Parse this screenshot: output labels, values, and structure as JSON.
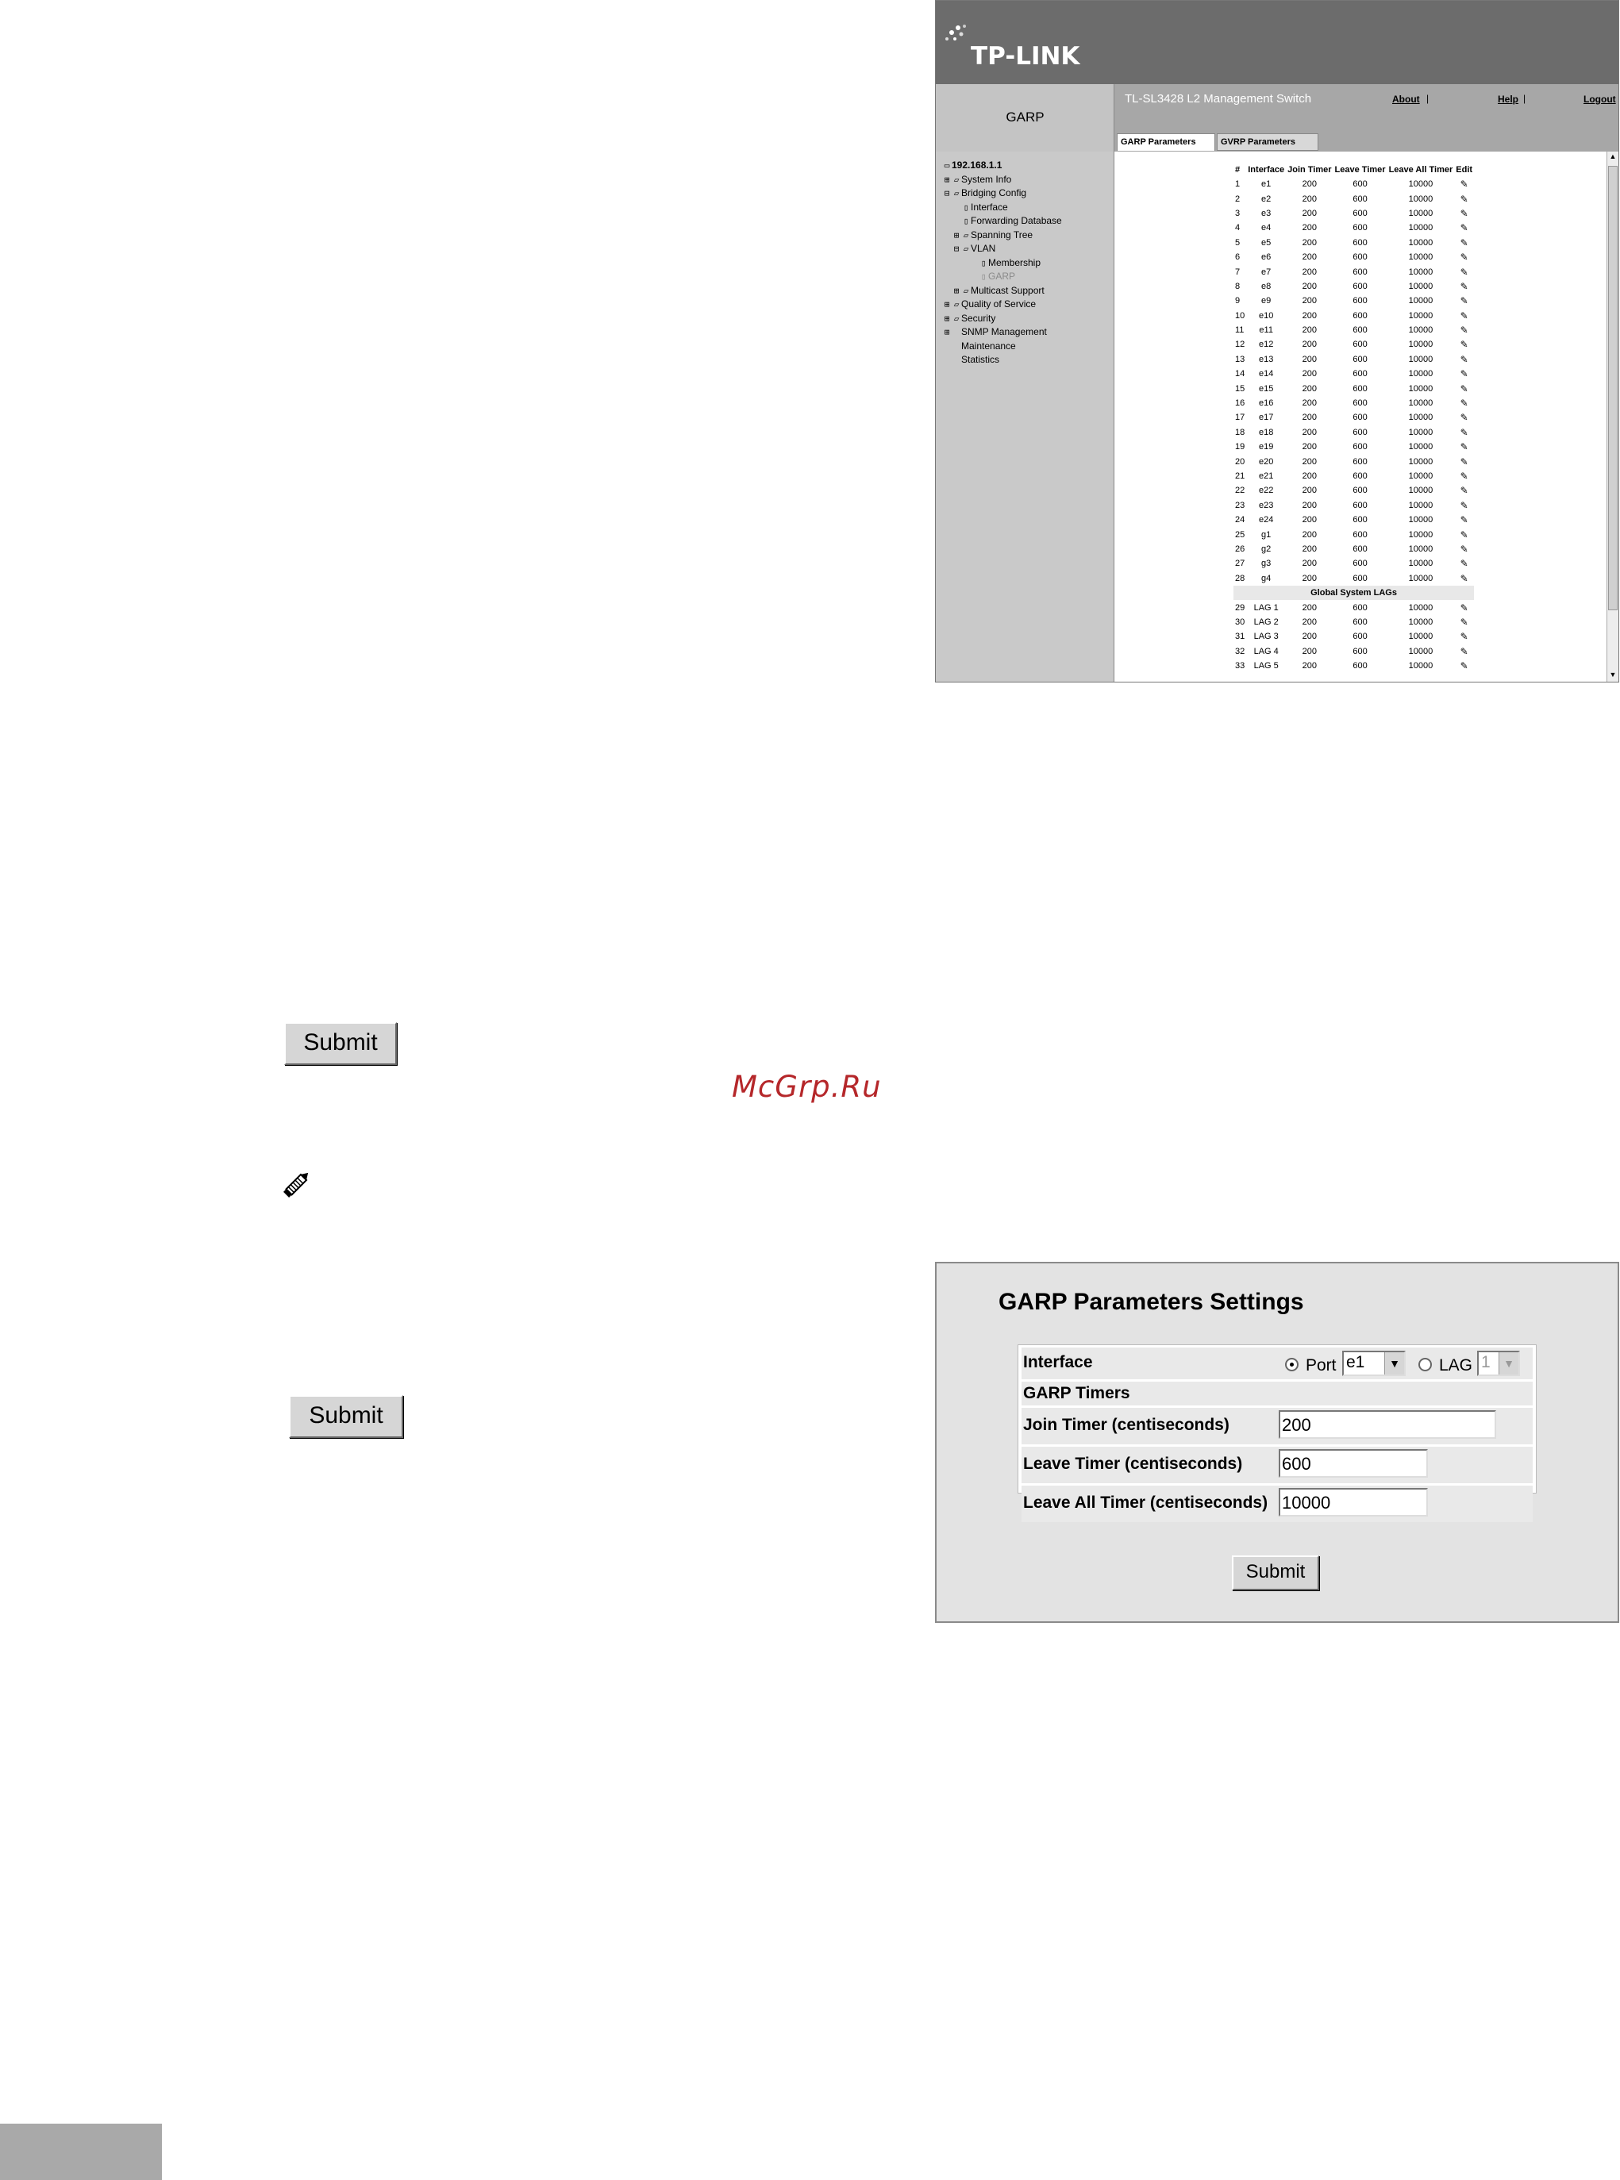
{
  "screenshot1": {
    "logo": "TP-LINK",
    "page_label": "GARP",
    "product": "TL-SL3428 L2 Management Switch",
    "links": {
      "about": "About",
      "help": "Help",
      "logout": "Logout",
      "sep": "|"
    },
    "tabs": [
      "GARP Parameters",
      "GVRP Parameters"
    ],
    "tree": {
      "root": "192.168.1.1",
      "system_info": "System Info",
      "bridging_config": "Bridging Config",
      "interface": "Interface",
      "forwarding_database": "Forwarding Database",
      "spanning_tree": "Spanning Tree",
      "vlan": "VLAN",
      "membership": "Membership",
      "garp": "GARP",
      "multicast_support": "Multicast Support",
      "quality_of_service": "Quality of Service",
      "security": "Security",
      "snmp_management": "SNMP Management",
      "maintenance": "Maintenance",
      "statistics": "Statistics"
    },
    "table": {
      "headers": [
        "#",
        "Interface",
        "Join Timer",
        "Leave Timer",
        "Leave All Timer",
        "Edit"
      ],
      "rows": [
        [
          "1",
          "e1",
          "200",
          "600",
          "10000"
        ],
        [
          "2",
          "e2",
          "200",
          "600",
          "10000"
        ],
        [
          "3",
          "e3",
          "200",
          "600",
          "10000"
        ],
        [
          "4",
          "e4",
          "200",
          "600",
          "10000"
        ],
        [
          "5",
          "e5",
          "200",
          "600",
          "10000"
        ],
        [
          "6",
          "e6",
          "200",
          "600",
          "10000"
        ],
        [
          "7",
          "e7",
          "200",
          "600",
          "10000"
        ],
        [
          "8",
          "e8",
          "200",
          "600",
          "10000"
        ],
        [
          "9",
          "e9",
          "200",
          "600",
          "10000"
        ],
        [
          "10",
          "e10",
          "200",
          "600",
          "10000"
        ],
        [
          "11",
          "e11",
          "200",
          "600",
          "10000"
        ],
        [
          "12",
          "e12",
          "200",
          "600",
          "10000"
        ],
        [
          "13",
          "e13",
          "200",
          "600",
          "10000"
        ],
        [
          "14",
          "e14",
          "200",
          "600",
          "10000"
        ],
        [
          "15",
          "e15",
          "200",
          "600",
          "10000"
        ],
        [
          "16",
          "e16",
          "200",
          "600",
          "10000"
        ],
        [
          "17",
          "e17",
          "200",
          "600",
          "10000"
        ],
        [
          "18",
          "e18",
          "200",
          "600",
          "10000"
        ],
        [
          "19",
          "e19",
          "200",
          "600",
          "10000"
        ],
        [
          "20",
          "e20",
          "200",
          "600",
          "10000"
        ],
        [
          "21",
          "e21",
          "200",
          "600",
          "10000"
        ],
        [
          "22",
          "e22",
          "200",
          "600",
          "10000"
        ],
        [
          "23",
          "e23",
          "200",
          "600",
          "10000"
        ],
        [
          "24",
          "e24",
          "200",
          "600",
          "10000"
        ],
        [
          "25",
          "g1",
          "200",
          "600",
          "10000"
        ],
        [
          "26",
          "g2",
          "200",
          "600",
          "10000"
        ],
        [
          "27",
          "g3",
          "200",
          "600",
          "10000"
        ],
        [
          "28",
          "g4",
          "200",
          "600",
          "10000"
        ]
      ],
      "lag_section_label": "Global System LAGs",
      "lag_rows": [
        [
          "29",
          "LAG 1",
          "200",
          "600",
          "10000"
        ],
        [
          "30",
          "LAG 2",
          "200",
          "600",
          "10000"
        ],
        [
          "31",
          "LAG 3",
          "200",
          "600",
          "10000"
        ],
        [
          "32",
          "LAG 4",
          "200",
          "600",
          "10000"
        ],
        [
          "33",
          "LAG 5",
          "200",
          "600",
          "10000"
        ]
      ],
      "edit_icon": "pencil-icon"
    }
  },
  "buttons": {
    "submit_label": "Submit"
  },
  "watermark": "McGrp.Ru",
  "screenshot2": {
    "title": "GARP Parameters Settings",
    "interface_label": "Interface",
    "port_label": "Port",
    "port_value": "e1",
    "lag_label": "LAG",
    "lag_value": "1",
    "garp_timers_label": "GARP Timers",
    "join_label": "Join Timer (centiseconds)",
    "join_value": "200",
    "leave_label": "Leave Timer (centiseconds)",
    "leave_value": "600",
    "leave_all_label": "Leave All Timer (centiseconds)",
    "leave_all_value": "10000",
    "submit_label": "Submit"
  }
}
